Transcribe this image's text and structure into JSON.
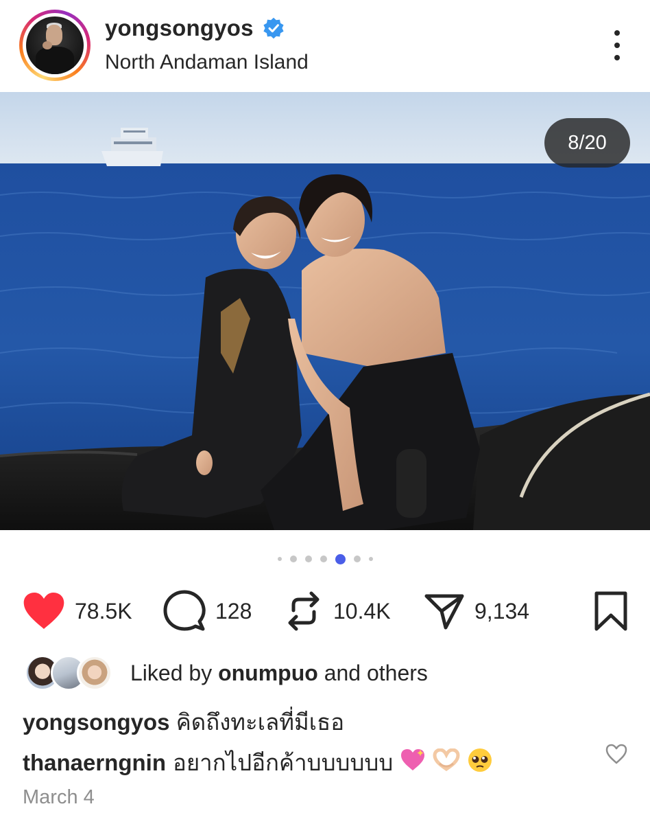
{
  "post": {
    "username": "yongsongyos",
    "location": "North Andaman Island",
    "verified": true,
    "image_counter": "8/20",
    "carousel": {
      "dots_visible": 7,
      "active_dot": 5
    }
  },
  "actions": {
    "likes": "78.5K",
    "comments": "128",
    "reposts": "10.4K",
    "shares": "9,134"
  },
  "liked_by": {
    "prefix": "Liked by",
    "user": "onumpuo",
    "suffix": "and others"
  },
  "caption": {
    "username": "yongsongyos",
    "text": "คิดถึงทะเลที่มีเธอ"
  },
  "comment": {
    "username": "thanaerngnin",
    "text": "อยากไปอีกค้าบบบบบบ"
  },
  "date": "March 4",
  "colors": {
    "like_red": "#ff3040",
    "verified_blue": "#3897f0",
    "active_dot": "#4a5ee8",
    "text": "#262626",
    "muted": "#8e8e8e"
  },
  "icons": [
    "verified-badge-icon",
    "more-options-icon",
    "heart-icon",
    "comment-icon",
    "repost-icon",
    "share-icon",
    "bookmark-icon",
    "comment-like-icon"
  ]
}
